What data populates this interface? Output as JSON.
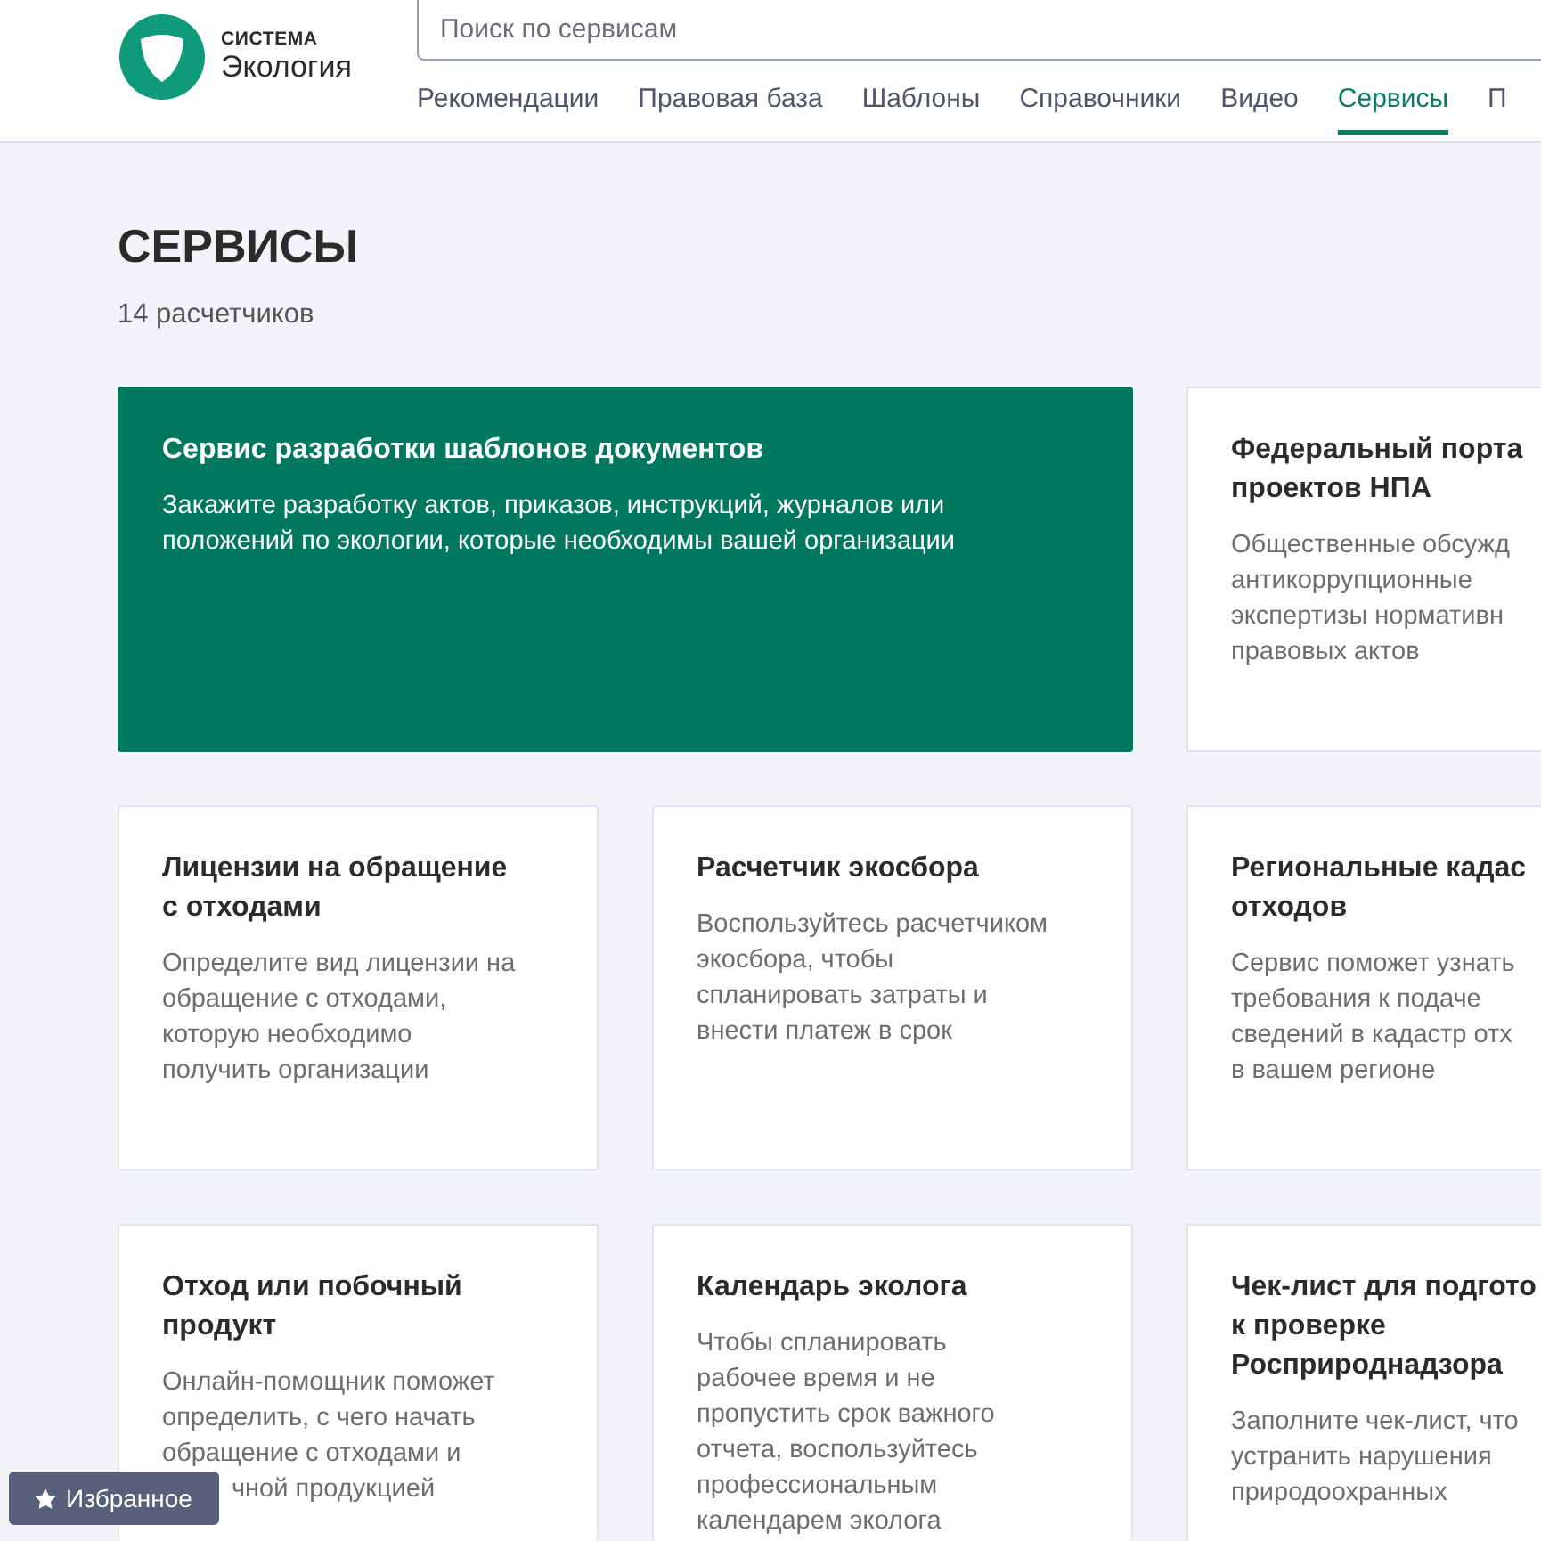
{
  "logo": {
    "caption": "СИСТЕМА",
    "name": "Экология"
  },
  "search": {
    "placeholder": "Поиск по сервисам"
  },
  "nav": [
    {
      "label": "Рекомендации",
      "selected": false
    },
    {
      "label": "Правовая база",
      "selected": false
    },
    {
      "label": "Шаблоны",
      "selected": false
    },
    {
      "label": "Справочники",
      "selected": false
    },
    {
      "label": "Видео",
      "selected": false
    },
    {
      "label": "Сервисы",
      "selected": true
    },
    {
      "label": "П",
      "selected": false
    }
  ],
  "page": {
    "title": "СЕРВИСЫ",
    "count": "14 расчетчиков"
  },
  "cards": [
    {
      "kind": "featured",
      "title": "Сервис разработки шаблонов документов",
      "text": "Закажите разработку актов, приказов, инструкций, журналов или\nположений по экологии, которые необходимы вашей организации"
    },
    {
      "kind": "regular",
      "title": "Федеральный порта\nпроектов НПА",
      "text": "Общественные обсужд\nантикоррупционные\nэкспертизы нормативн\nправовых актов"
    },
    {
      "kind": "regular",
      "title": "Лицензии на обращение\nс отходами",
      "text": "Определите вид лицензии на\nобращение с отходами,\nкоторую необходимо\nполучить организации"
    },
    {
      "kind": "regular",
      "title": "Расчетчик экосбора",
      "text": "Воспользуйтесь расчетчиком\nэкосбора, чтобы\nспланировать затраты и\nвнести платеж в срок"
    },
    {
      "kind": "regular",
      "title": "Региональные кадас\nотходов",
      "text": "Сервис поможет узнать\nтребования к подаче\nсведений в кадастр отх\nв вашем регионе"
    },
    {
      "kind": "regular",
      "title": "Отход или побочный\nпродукт",
      "text": "Онлайн-помощник поможет\nопределить, с чего начать\nобращение с отходами и",
      "text_tail": "чной продукцией"
    },
    {
      "kind": "regular",
      "title": "Календарь эколога",
      "text": "Чтобы спланировать\nрабочее время и не\nпропустить срок важного\nотчета, воспользуйтесь\nпрофессиональным\nкалендарем эколога"
    },
    {
      "kind": "regular",
      "title": "Чек-лист для подгото\nк проверке\nРосприроднадзора",
      "text": "Заполните чек-лист, что\nустранить нарушения\nприродоохранных"
    }
  ],
  "favorites": {
    "label": "Избранное"
  }
}
